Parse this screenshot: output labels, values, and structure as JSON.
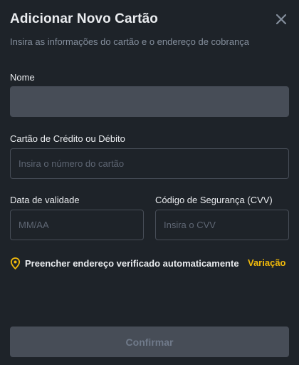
{
  "dialog": {
    "title": "Adicionar Novo Cartão",
    "subtitle": "Insira as informações do cartão e o endereço de cobrança"
  },
  "form": {
    "name": {
      "label": "Nome",
      "value": "",
      "placeholder": ""
    },
    "card_number": {
      "label": "Cartão de Crédito ou Débito",
      "value": "",
      "placeholder": "Insira o número do cartão"
    },
    "expiry": {
      "label": "Data de validade",
      "value": "",
      "placeholder": "MM/AA"
    },
    "cvv": {
      "label": "Código de Segurança (CVV)",
      "value": "",
      "placeholder": "Insira o CVV"
    }
  },
  "autofill": {
    "icon": "location-pin-icon",
    "label": "Preencher endereço verificado automaticamente",
    "link_label": "Variação"
  },
  "actions": {
    "confirm_label": "Confirmar",
    "close_icon": "close-icon"
  },
  "colors": {
    "background": "#1e2329",
    "input_border": "#474d57",
    "accent": "#f0b90b",
    "text_primary": "#eaecef",
    "text_secondary": "#848e9c",
    "placeholder": "#5e6673"
  }
}
